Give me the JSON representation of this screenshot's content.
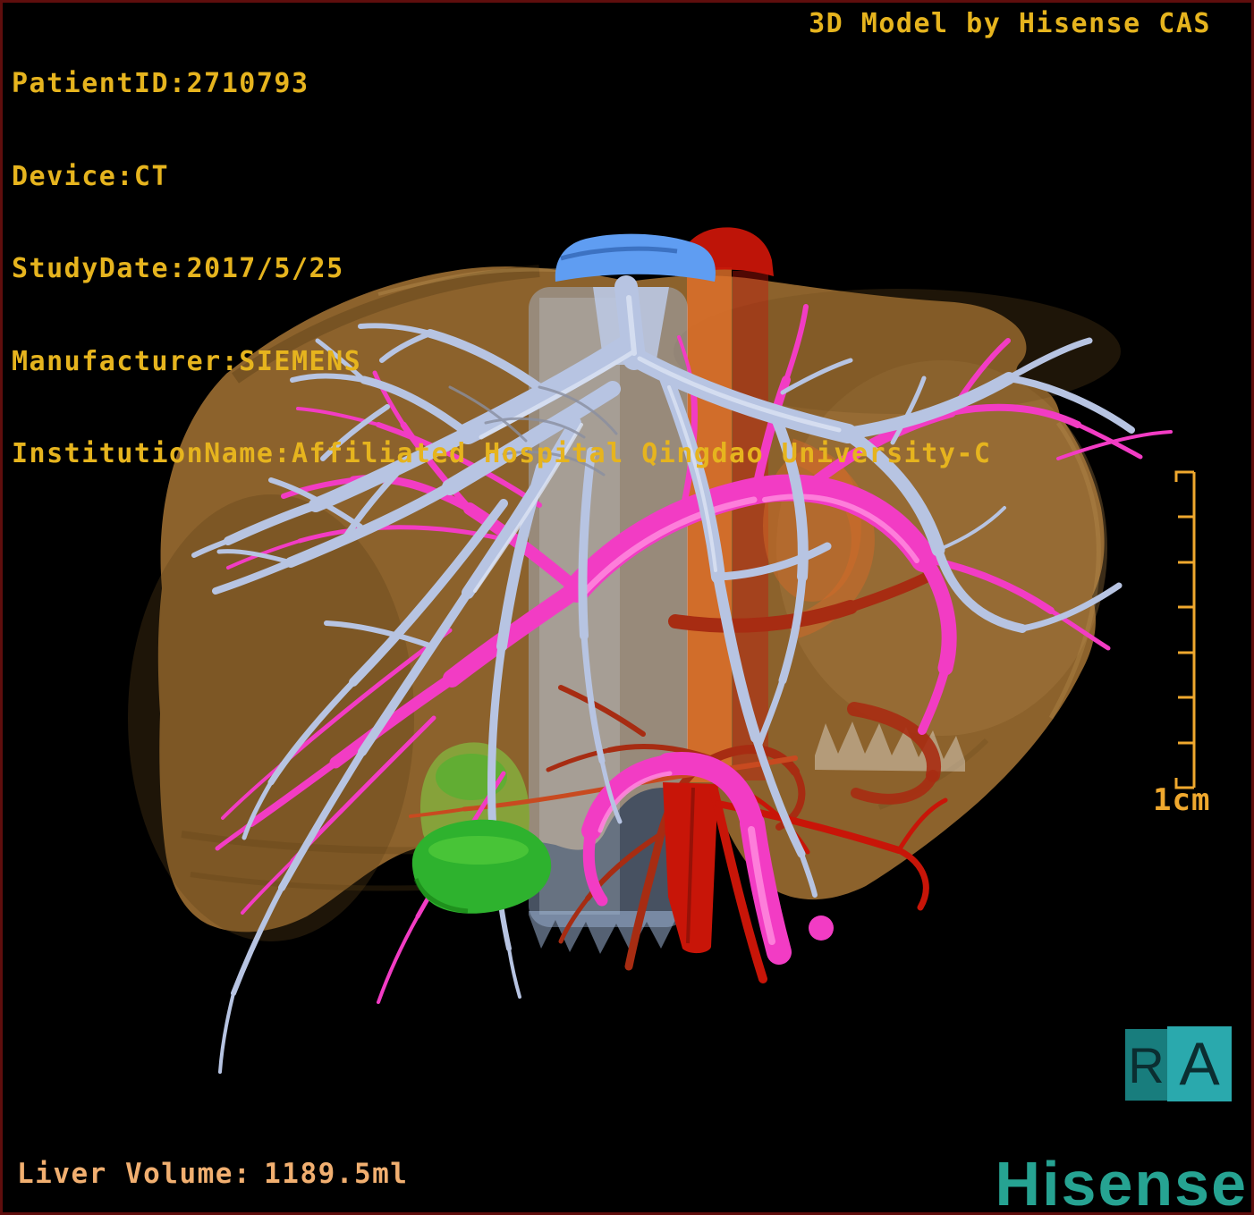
{
  "overlay": {
    "patient_info_lines": [
      "PatientID:2710793",
      "Device:CT",
      "StudyDate:2017/5/25",
      "Manufacturer:SIEMENS",
      "InstitutionName:Affiliated Hospital Qingdao University-C"
    ],
    "patient": {
      "patient_id": "2710793",
      "device": "CT",
      "study_date": "2017/5/25",
      "manufacturer": "SIEMENS",
      "institution_name": "Affiliated Hospital Qingdao University-C"
    },
    "watermark": "3D Model by Hisense CAS",
    "liver_volume": {
      "label": "Liver Volume:",
      "value": "1189.5ml"
    },
    "scale_label": "1cm",
    "orientation": {
      "right_marker": "R",
      "anterior_marker": "A"
    },
    "brand": "Hisense"
  },
  "colors": {
    "background": "#000000",
    "frame_border": "#5f0e0d",
    "info_text": "#e6b41e",
    "volume_text": "#f1af70",
    "ruler": "#efa82e",
    "brand_teal": "#26a392",
    "marker_r_bg": "#187d7d",
    "marker_a_bg": "#2aa9ad",
    "marker_glyph": "#0b2e31",
    "liver": "#97692f",
    "hepatic_vein": "#b7c4e2",
    "hepatic_vein_light": "#dce4f4",
    "portal_vein": "#f23cc4",
    "portal_light": "#ff8ade",
    "hepatic_artery": "#a72c12",
    "aorta_orange": "#e0702a",
    "aorta_red": "#c81508",
    "ivc": "#aac2e6",
    "ivc_cap": "#5f9df2",
    "gallbladder": "#2eb22e",
    "gallbladder_dim": "#85a73c",
    "gallbladder_light": "#5ed33f"
  },
  "model": {
    "structures": [
      {
        "name": "liver",
        "color": "#97692f"
      },
      {
        "name": "hepatic-veins",
        "color": "#b7c4e2"
      },
      {
        "name": "portal-vein",
        "color": "#f23cc4"
      },
      {
        "name": "hepatic-artery",
        "color": "#a72c12"
      },
      {
        "name": "aorta",
        "color": "#c81508"
      },
      {
        "name": "inferior-vena-cava",
        "color": "#aac2e6"
      },
      {
        "name": "gallbladder",
        "color": "#2eb22e"
      }
    ]
  }
}
